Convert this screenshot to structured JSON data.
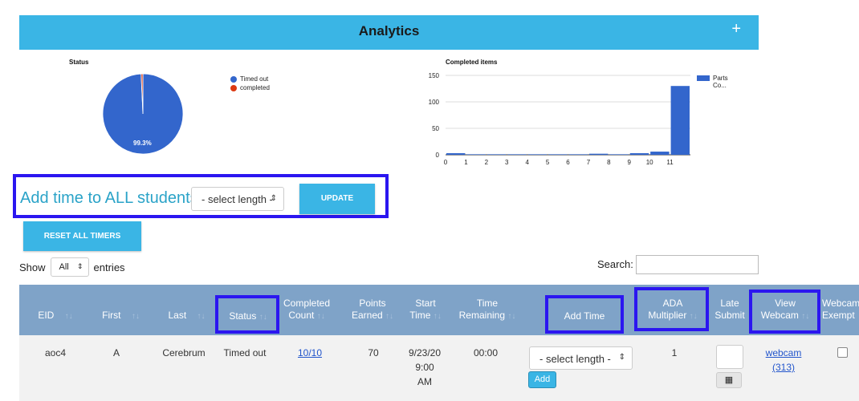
{
  "header": {
    "title": "Analytics",
    "expand_icon": "+"
  },
  "status_chart": {
    "title": "Status",
    "pie_label": "99.3%",
    "legend": [
      {
        "label": "Timed out",
        "color": "#3366cc"
      },
      {
        "label": "completed",
        "color": "#dc3912"
      }
    ]
  },
  "chart_data": [
    {
      "type": "pie",
      "title": "Status",
      "labels": [
        "Timed out",
        "completed"
      ],
      "values": [
        99.3,
        0.7
      ],
      "colors": [
        "#3366cc",
        "#dc3912"
      ],
      "legend": "right"
    },
    {
      "type": "bar",
      "title": "Completed items",
      "categories": [
        "0",
        "1",
        "2",
        "3",
        "4",
        "5",
        "6",
        "7",
        "8",
        "9",
        "10",
        "11"
      ],
      "series": [
        {
          "name": "Parts Co...",
          "values": [
            3,
            1,
            1,
            1,
            1,
            1,
            1,
            2,
            1,
            3,
            6,
            130
          ],
          "color": "#3366cc"
        }
      ],
      "ylim": [
        0,
        150
      ],
      "yticks": [
        "0",
        "50",
        "100",
        "150"
      ],
      "grid": true,
      "legend": "top-right"
    }
  ],
  "bar_chart": {
    "title": "Completed items",
    "legend_label_1": "Parts",
    "legend_label_2": "Co..."
  },
  "add_time": {
    "label": "Add time to ALL students",
    "select_value": "- select length -",
    "update_label": "UPDATE",
    "reset_label": "RESET ALL TIMERS"
  },
  "table_controls": {
    "show_label": "Show",
    "entries_value": "All",
    "entries_label": "entries",
    "search_label": "Search:"
  },
  "columns": [
    {
      "line1": "EID",
      "line2": ""
    },
    {
      "line1": "First",
      "line2": ""
    },
    {
      "line1": "Last",
      "line2": ""
    },
    {
      "line1": "Status",
      "line2": ""
    },
    {
      "line1": "Completed",
      "line2": "Count"
    },
    {
      "line1": "Points",
      "line2": "Earned"
    },
    {
      "line1": "Start",
      "line2": "Time"
    },
    {
      "line1": "Time",
      "line2": "Remaining"
    },
    {
      "line1": "Add Time",
      "line2": ""
    },
    {
      "line1": "ADA",
      "line2": "Multiplier"
    },
    {
      "line1": "Late",
      "line2": "Submit"
    },
    {
      "line1": "View",
      "line2": "Webcam"
    },
    {
      "line1": "Webcam",
      "line2": "Exempt"
    }
  ],
  "sort_icon": "↑↓",
  "rows": [
    {
      "eid": "aoc4",
      "first": "A",
      "last": "Cerebrum",
      "status": "Timed out",
      "completed": "10/10",
      "points": "70",
      "start_1": "9/23/20",
      "start_2": "9:00",
      "start_3": "AM",
      "remaining": "00:00",
      "add_select": "- select length -",
      "add_btn": "Add",
      "ada": "1",
      "webcam_1": "webcam",
      "webcam_2": "(313)",
      "calendar_icon": "▦"
    }
  ],
  "accent_color": "#3ab5e5",
  "highlight_color": "#2b16f0"
}
